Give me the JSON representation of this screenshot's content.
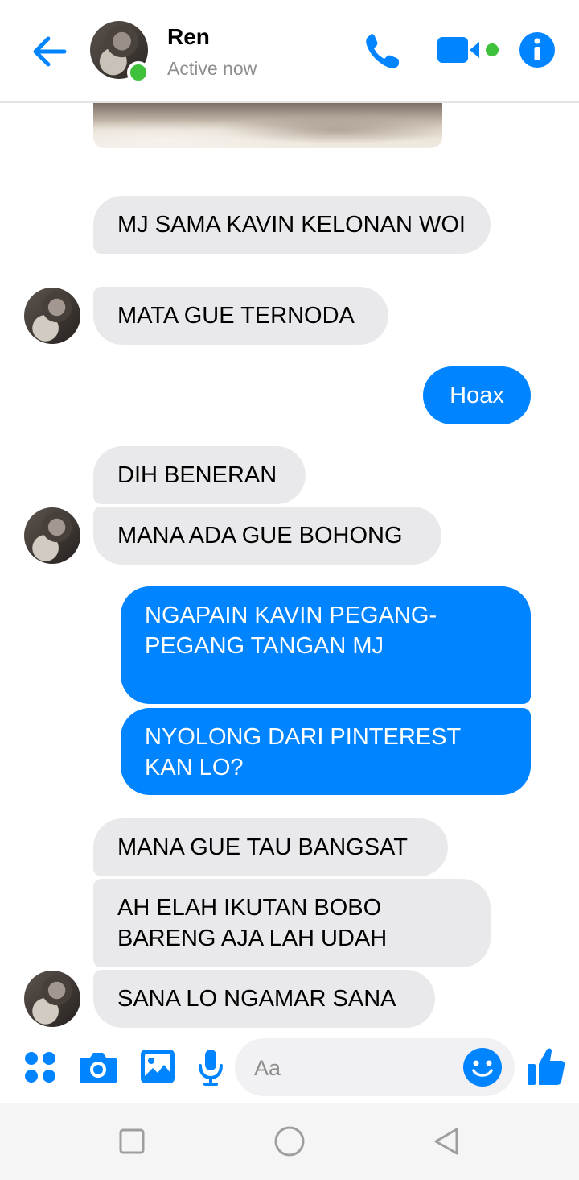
{
  "header": {
    "contact_name": "Ren",
    "status": "Active now"
  },
  "messages": [
    {
      "side": "in",
      "text": "MJ SAMA KAVIN KELONAN WOI"
    },
    {
      "side": "in",
      "text": "MATA GUE TERNODA"
    },
    {
      "side": "out",
      "text": "Hoax"
    },
    {
      "side": "in",
      "text": "DIH BENERAN"
    },
    {
      "side": "in",
      "text": "MANA ADA GUE BOHONG"
    },
    {
      "side": "out",
      "text": "NGAPAIN KAVIN PEGANG-PEGANG TANGAN MJ"
    },
    {
      "side": "out",
      "text": "NYOLONG DARI PINTEREST KAN LO?"
    },
    {
      "side": "in",
      "text": "MANA GUE TAU BANGSAT"
    },
    {
      "side": "in",
      "text": "AH ELAH IKUTAN BOBO BARENG AJA LAH UDAH"
    },
    {
      "side": "in",
      "text": "SANA LO NGAMAR SANA"
    }
  ],
  "composer": {
    "placeholder": "Aa"
  },
  "icons": {
    "back": "back-arrow-icon",
    "call": "phone-icon",
    "video": "video-camera-icon",
    "info": "info-icon",
    "apps": "four-dots-icon",
    "camera": "camera-icon",
    "gallery": "image-icon",
    "mic": "microphone-icon",
    "emoji": "smiley-icon",
    "like": "thumbs-up-icon"
  },
  "colors": {
    "accent": "#0084ff",
    "incoming_bubble": "#e9e9eb",
    "online": "#3fc13b"
  }
}
